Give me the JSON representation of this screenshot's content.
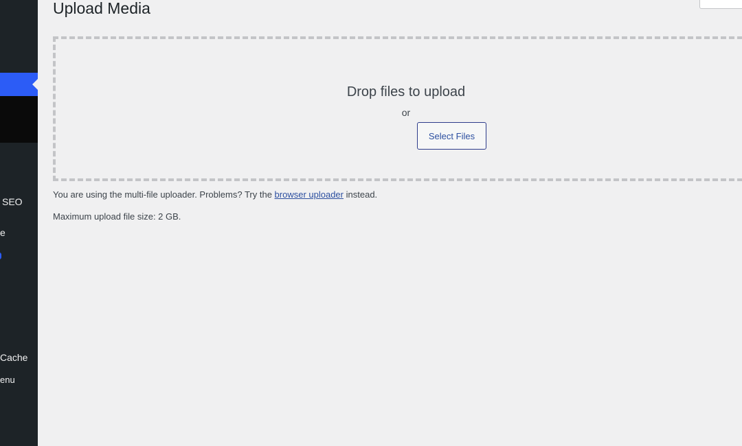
{
  "sidebar": {
    "items": [
      {
        "label": "SEO"
      },
      {
        "label": "e"
      },
      {
        "label": "Cache"
      },
      {
        "label": "enu"
      }
    ]
  },
  "header": {
    "title": "Upload Media"
  },
  "uploader": {
    "drop_text": "Drop files to upload",
    "or_text": "or",
    "select_button": "Select Files",
    "info_prefix": "You are using the multi-file uploader. Problems? Try the",
    "info_link": "browser uploader",
    "info_suffix": "instead.",
    "max_size": "Maximum upload file size: 2 GB."
  },
  "colors": {
    "sidebar_bg": "#1d2327",
    "accent": "#2c5cf6",
    "link": "#2c4fa0",
    "page_bg": "#f0f0f1"
  }
}
